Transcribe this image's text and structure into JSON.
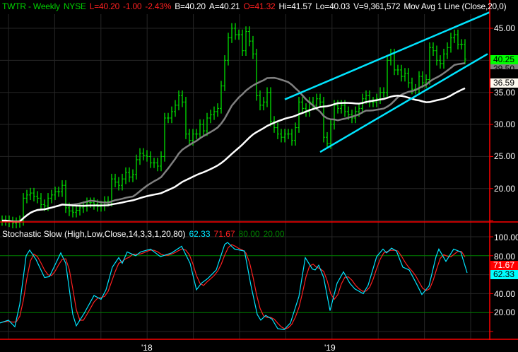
{
  "header": {
    "symbol": "TWTR - Weekly",
    "exchange": "NYSE",
    "last": "L=40.20",
    "change": "-1.00",
    "change_pct": "-2.43%",
    "bid": "B=40.20",
    "ask": "A=40.21",
    "open": "O=41.32",
    "high": "Hi=41.57",
    "low": "Lo=40.03",
    "volume": "V=9,361,572",
    "study": "Mov Avg 1 Line (Close,20,0)"
  },
  "stoch_header": {
    "title": "Stochastic Slow (High,Low,Close,14,3,3,1,20,80)",
    "k_value": "62.33",
    "d_value": "71.67",
    "overbought": "80.00",
    "oversold": "20.00"
  },
  "colors": {
    "bar": "#00e000",
    "ma_short": "#808080",
    "ma_long": "#ffffff",
    "trend": "#00e5ff",
    "k": "#00e5ff",
    "d": "#ff2020",
    "axis": "#ff0000",
    "level": "#008000"
  },
  "price_axis": {
    "labels": [
      "45.00",
      "40.00",
      "35.00",
      "30.00",
      "25.00",
      "20.00"
    ],
    "ticks": [
      45,
      40,
      35,
      30,
      25,
      20,
      15
    ],
    "range": [
      15,
      45
    ]
  },
  "price_boxes": {
    "last": "40.25",
    "ma_short": "39.50",
    "ma_long": "36.59"
  },
  "stoch_axis": {
    "labels": [
      "100.00",
      "80.00",
      "40.00",
      "20.00"
    ],
    "ticks": [
      100,
      80,
      60,
      40,
      20,
      0
    ]
  },
  "stoch_boxes": {
    "d": "71.67",
    "k": "62.33"
  },
  "date_labels": [
    {
      "label": "'18",
      "week": 41
    },
    {
      "label": "'19",
      "week": 93
    }
  ],
  "chart_data": {
    "type": "ohlc",
    "interval": "weekly",
    "default_wick": 0.8,
    "close": [
      15,
      15,
      14.8,
      14.6,
      14.7,
      15,
      18.5,
      19,
      19.3,
      18.8,
      18.5,
      17.5,
      17.3,
      18.5,
      19,
      19.5,
      19.5,
      20.5,
      17,
      16.5,
      16.3,
      16.6,
      17,
      17.2,
      17.8,
      17.8,
      17.5,
      17.2,
      17.3,
      18,
      18,
      21.5,
      21,
      20.5,
      21.5,
      22.5,
      21.8,
      22.2,
      24.5,
      25.5,
      25.2,
      25,
      24,
      24,
      23.5,
      25,
      31,
      31,
      32,
      33,
      34.5,
      33.5,
      28.5,
      27.5,
      28.5,
      28.5,
      30,
      29,
      31,
      31.5,
      32,
      32.5,
      36,
      40,
      43.5,
      45,
      44,
      44,
      41.5,
      44.5,
      43,
      41,
      34.5,
      33,
      33.5,
      35,
      30.5,
      29.5,
      28.5,
      28,
      28.5,
      28.5,
      27.5,
      29.5,
      33.5,
      32.5,
      32,
      33.5,
      33,
      34,
      33.5,
      28,
      27,
      30,
      33,
      32.5,
      33,
      32,
      31.5,
      31,
      32,
      32.5,
      34,
      34.5,
      33.5,
      33.5,
      34,
      35,
      35,
      40,
      41,
      38.5,
      38.5,
      37.5,
      38,
      36.5,
      35.5,
      35.5,
      37.5,
      36.5,
      37,
      42,
      41.5,
      40,
      39.5,
      41,
      42,
      43.5,
      44,
      42.5,
      42.5,
      40.2
    ],
    "moving_averages": [
      {
        "name": "MA 20",
        "period": 20
      },
      {
        "name": "MA 50",
        "period": 50
      }
    ],
    "trendlines": [
      {
        "name": "upper channel",
        "from": [
          80,
          33.9
        ],
        "to": [
          138,
          47.5
        ]
      },
      {
        "name": "lower channel",
        "from": [
          90,
          25.7
        ],
        "to": [
          137.4,
          41.0
        ]
      }
    ],
    "stochastic_k": [
      [
        -0.6,
        9
      ],
      [
        1.8,
        12
      ],
      [
        3.6,
        5
      ],
      [
        5,
        29
      ],
      [
        6.8,
        80
      ],
      [
        7.8,
        86
      ],
      [
        9.6,
        76
      ],
      [
        12,
        57
      ],
      [
        13.4,
        58
      ],
      [
        16.6,
        83
      ],
      [
        18,
        72
      ],
      [
        20,
        18
      ],
      [
        21,
        6
      ],
      [
        23.2,
        19
      ],
      [
        26,
        38
      ],
      [
        28,
        34
      ],
      [
        29.4,
        44
      ],
      [
        31.2,
        68
      ],
      [
        33,
        78
      ],
      [
        34,
        72
      ],
      [
        35.4,
        84
      ],
      [
        37.8,
        80
      ],
      [
        39.2,
        84
      ],
      [
        42,
        87
      ],
      [
        44.8,
        79
      ],
      [
        48,
        83
      ],
      [
        50.8,
        90
      ],
      [
        53.2,
        72
      ],
      [
        55,
        44
      ],
      [
        56.4,
        51
      ],
      [
        58.2,
        56
      ],
      [
        60.6,
        65
      ],
      [
        63,
        92
      ],
      [
        63.8,
        94
      ],
      [
        65.8,
        87
      ],
      [
        68.6,
        85
      ],
      [
        70.4,
        49
      ],
      [
        72.2,
        18
      ],
      [
        73.2,
        12
      ],
      [
        74.6,
        17
      ],
      [
        76.4,
        13
      ],
      [
        78,
        3
      ],
      [
        79.8,
        2
      ],
      [
        81.6,
        9
      ],
      [
        84,
        37
      ],
      [
        85.8,
        78
      ],
      [
        87.8,
        66
      ],
      [
        88.6,
        65
      ],
      [
        89.6,
        70
      ],
      [
        91,
        57
      ],
      [
        92.8,
        22
      ],
      [
        94.8,
        51
      ],
      [
        96.6,
        63
      ],
      [
        98.4,
        51
      ],
      [
        99.8,
        45
      ],
      [
        102.2,
        40
      ],
      [
        103.6,
        49
      ],
      [
        106,
        79
      ],
      [
        107.8,
        87
      ],
      [
        108.8,
        83
      ],
      [
        110.2,
        88
      ],
      [
        111.6,
        85
      ],
      [
        113.4,
        68
      ],
      [
        115.2,
        65
      ],
      [
        117.2,
        51
      ],
      [
        118.8,
        39
      ],
      [
        120.8,
        48
      ],
      [
        122.8,
        79
      ],
      [
        123.6,
        87
      ],
      [
        125.6,
        74
      ],
      [
        127.8,
        87
      ],
      [
        129.8,
        84
      ],
      [
        131.6,
        62
      ]
    ],
    "stochastic_levels": [
      80,
      20
    ],
    "ylim": [
      15,
      45
    ]
  }
}
